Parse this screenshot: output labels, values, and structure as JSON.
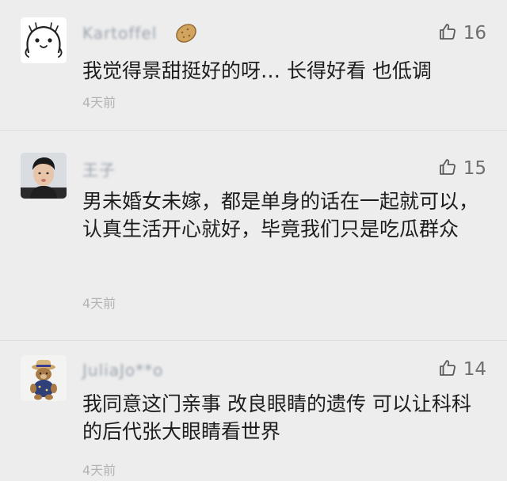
{
  "comments": [
    {
      "username": "Kartoffel",
      "avatar_icon": "cartoon-face-icon",
      "badge_icon": "potato-icon",
      "likes": "16",
      "text": "我觉得景甜挺好的呀… 长得好看 也低调",
      "time": "4天前"
    },
    {
      "username": "王子",
      "avatar_icon": "person-photo-avatar",
      "likes": "15",
      "text": "男未婚女未嫁，都是单身的话在一起就可以，认真生活开心就好，毕竟我们只是吃瓜群众",
      "time": "4天前"
    },
    {
      "username": "JuliaJo**o",
      "avatar_icon": "teddy-bear-avatar",
      "likes": "14",
      "text": "我同意这门亲事 改良眼睛的遗传 可以让科科的后代张大眼睛看世界",
      "time": "4天前"
    }
  ]
}
